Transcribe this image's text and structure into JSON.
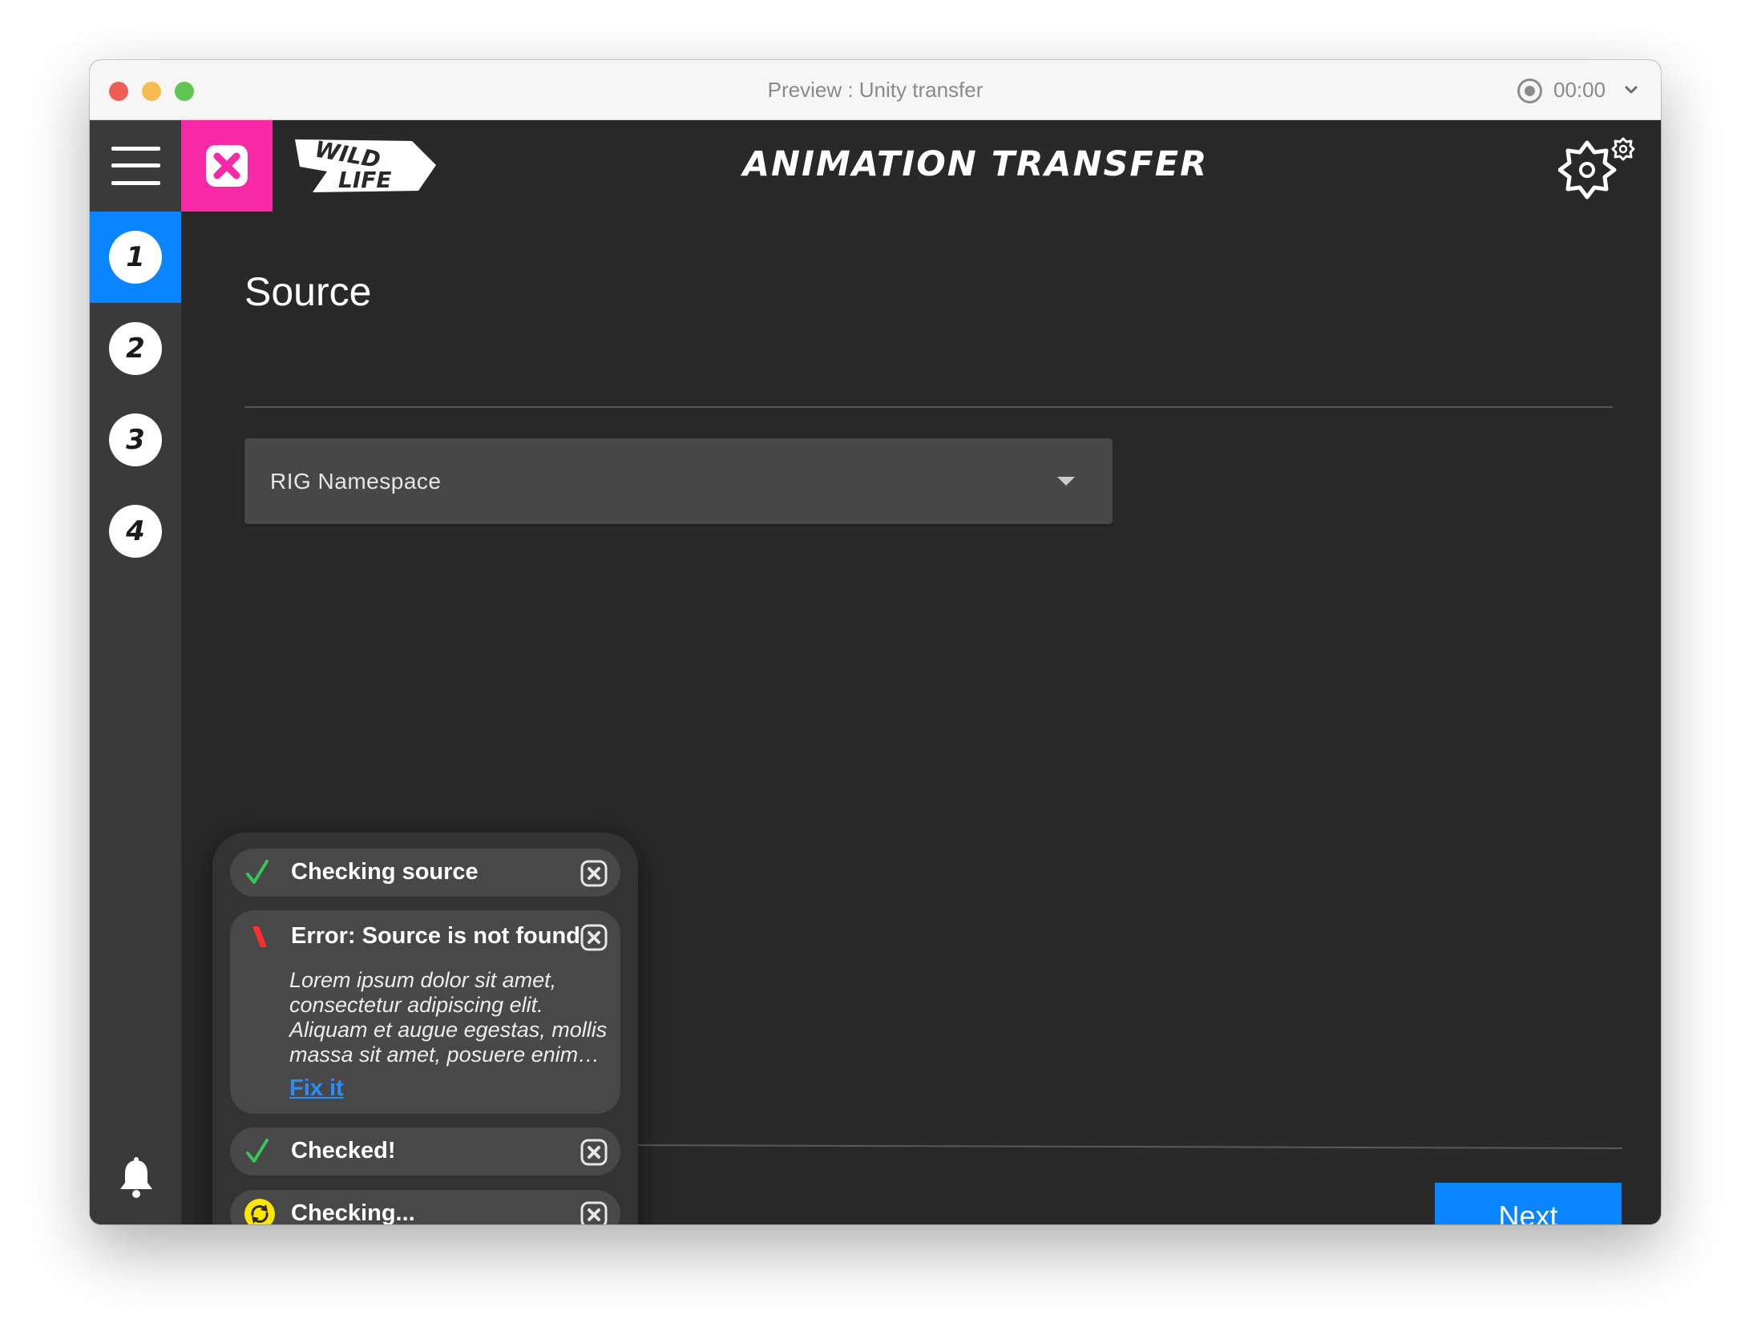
{
  "window": {
    "title": "Preview : Unity transfer",
    "timer": "00:00"
  },
  "header": {
    "app_title": "ANIMATION TRANSFER",
    "logo_text_line1": "WILD",
    "logo_text_line2": "LIFE",
    "brand_color": "#f729a7"
  },
  "sidebar": {
    "steps": [
      {
        "label": "1",
        "active": true
      },
      {
        "label": "2",
        "active": false
      },
      {
        "label": "3",
        "active": false
      },
      {
        "label": "4",
        "active": false
      }
    ],
    "active_color": "#0a84ff"
  },
  "main": {
    "section_title": "Source",
    "namespace_select": {
      "value": "RIG Namespace"
    },
    "next_label": "Next"
  },
  "notifications": [
    {
      "status": "success",
      "icon": "check-icon",
      "title": "Checking source"
    },
    {
      "status": "error",
      "icon": "error-icon",
      "title": "Error: Source is not found",
      "body": "Lorem ipsum dolor sit amet, consectetur adipiscing elit. Aliquam et augue egestas, mollis massa sit amet, posuere enim…",
      "link": "Fix it"
    },
    {
      "status": "success",
      "icon": "check-icon",
      "title": "Checked!"
    },
    {
      "status": "pending",
      "icon": "refresh-icon",
      "title": "Checking..."
    }
  ],
  "colors": {
    "success": "#34c759",
    "error": "#ff2d2d",
    "pending": "#ffe500",
    "accent": "#0a84ff"
  }
}
